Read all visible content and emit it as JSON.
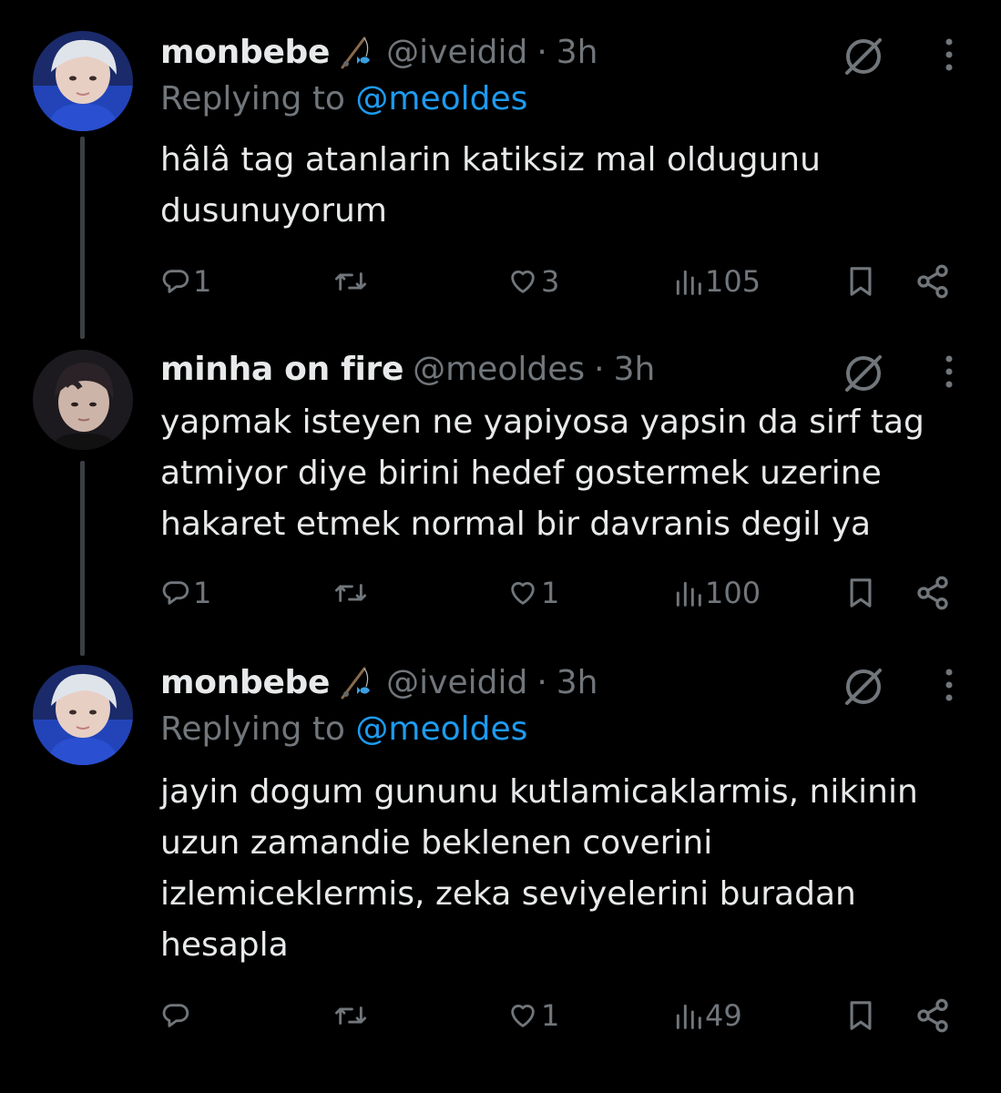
{
  "tweets": [
    {
      "display_name": "monbebe",
      "handle": "@iveidid",
      "dot": "·",
      "time": "3h",
      "replying_prefix": "Replying to ",
      "replying_to": "@meoldes",
      "text_lines": [
        "hâlâ tag atanlarin katiksiz mal oldugunu",
        "dusunuyorum"
      ],
      "replies": "1",
      "retweets": "",
      "likes": "3",
      "views": "105"
    },
    {
      "display_name": "minha on fire",
      "handle": "@meoldes",
      "dot": "·",
      "time": "3h",
      "text_lines": [
        "yapmak isteyen ne yapiyosa yapsin da sirf tag",
        "atmiyor diye birini hedef gostermek uzerine",
        "hakaret etmek normal bir davranis degil ya"
      ],
      "replies": "1",
      "retweets": "",
      "likes": "1",
      "views": "100"
    },
    {
      "display_name": "monbebe",
      "handle": "@iveidid",
      "dot": "·",
      "time": "3h",
      "replying_prefix": "Replying to ",
      "replying_to": "@meoldes",
      "text_lines": [
        "jayin dogum gununu kutlamicaklarmis, nikinin",
        "uzun zamandie beklenen coverini",
        "izlemiceklermis, zeka seviyelerini buradan",
        "hesapla"
      ],
      "replies": "",
      "retweets": "",
      "likes": "1",
      "views": "49"
    }
  ],
  "colors": {
    "background": "#000000",
    "text": "#e7e9ea",
    "muted": "#71767b",
    "link": "#1d9bf0",
    "thread_line": "#3a3f44"
  },
  "icons": [
    "reply-icon",
    "retweet-icon",
    "like-icon",
    "views-icon",
    "bookmark-icon",
    "share-icon",
    "grok-icon",
    "more-icon",
    "fishing-rod-emoji"
  ]
}
